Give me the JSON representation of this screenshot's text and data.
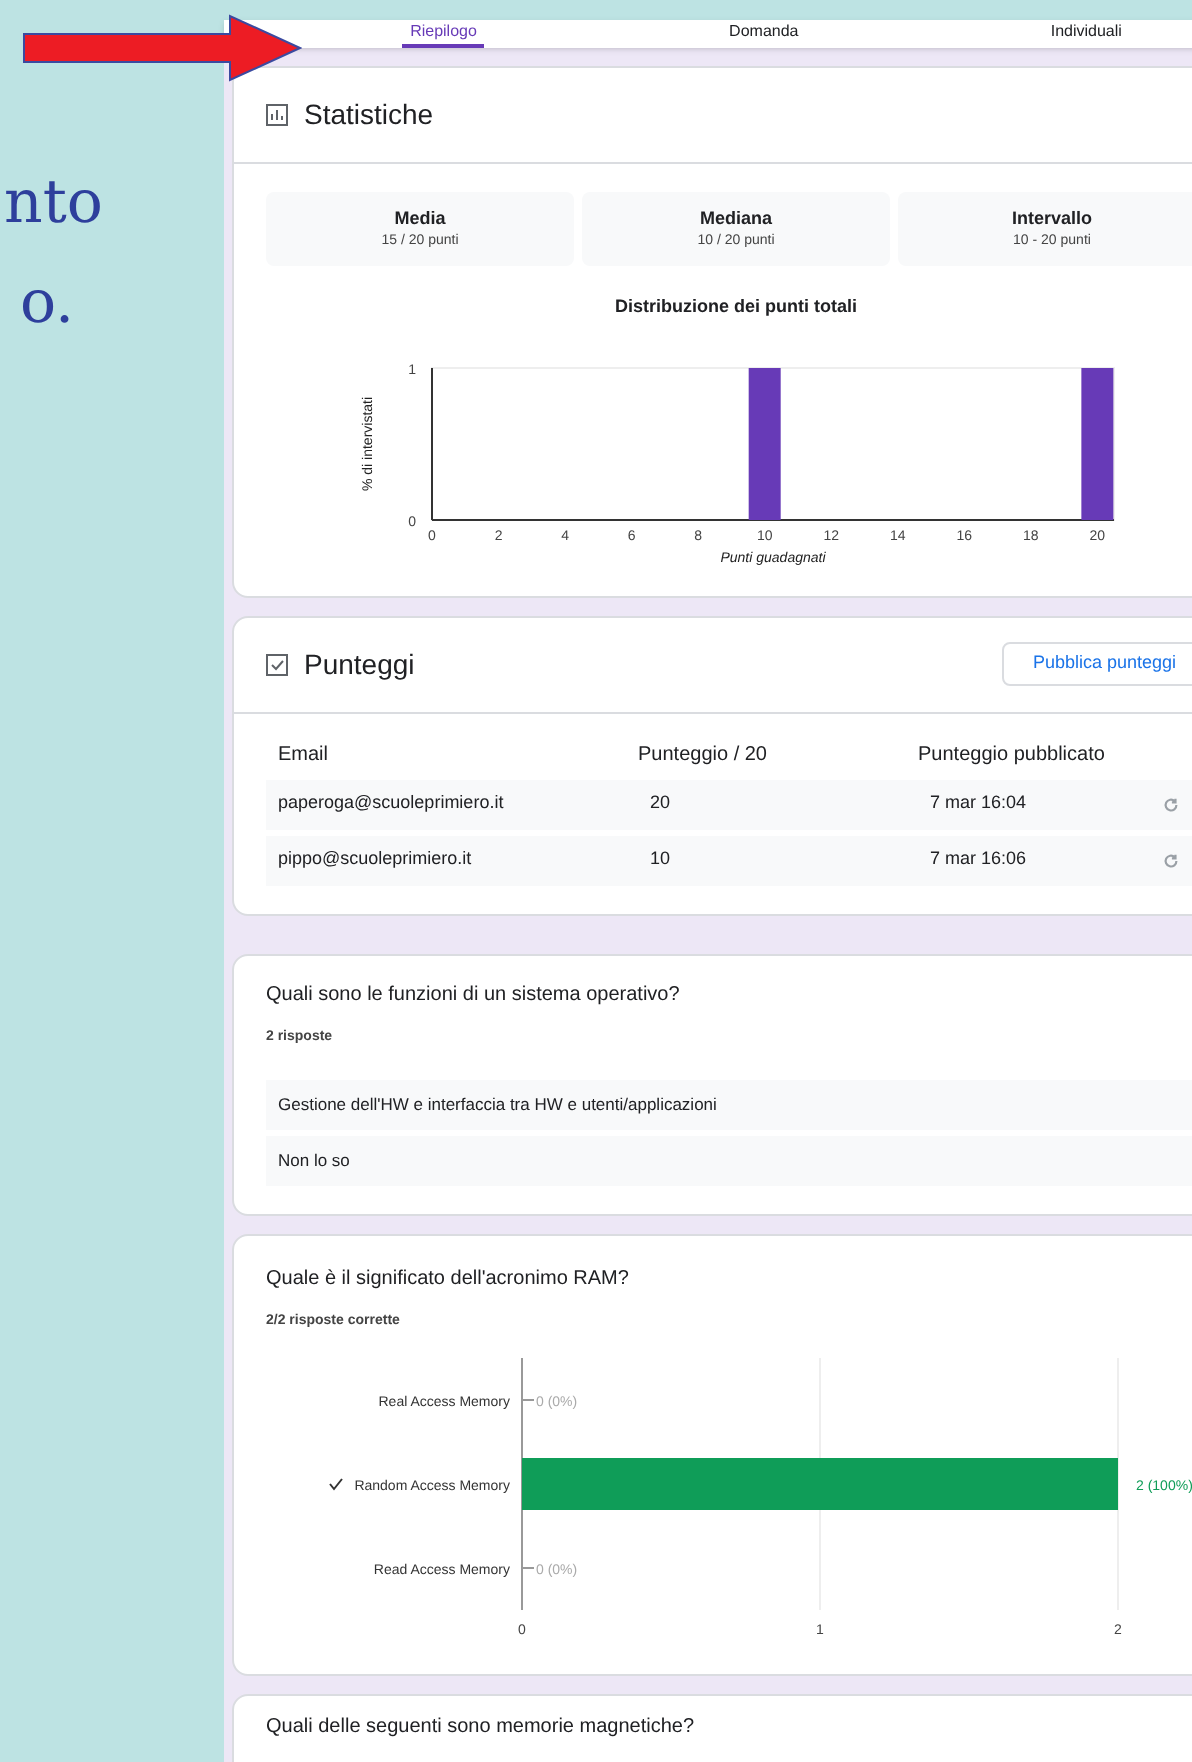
{
  "slide": {
    "text_lines": [
      "nto",
      "o."
    ]
  },
  "tabs": [
    {
      "label": "Riepilogo",
      "selected": true
    },
    {
      "label": "Domanda",
      "selected": false
    },
    {
      "label": "Individuali",
      "selected": false
    }
  ],
  "statistics": {
    "title": "Statistiche",
    "stats": [
      {
        "label": "Media",
        "value": "15 / 20 punti"
      },
      {
        "label": "Mediana",
        "value": "10 / 20 punti"
      },
      {
        "label": "Intervallo",
        "value": "10 - 20 punti"
      }
    ],
    "chart_data": {
      "type": "bar",
      "title": "Distribuzione dei punti totali",
      "xlabel": "Punti guadagnati",
      "ylabel": "% di intervistati",
      "x": [
        10,
        20
      ],
      "series": [
        {
          "color": "#673ab7",
          "values": [
            1,
            1
          ]
        }
      ],
      "xlim": [
        0,
        20.5
      ],
      "ylim": [
        0,
        1
      ],
      "xticks": [
        0,
        2,
        4,
        6,
        8,
        10,
        12,
        14,
        16,
        18,
        20
      ],
      "yticks": [
        0,
        1
      ]
    }
  },
  "scores": {
    "title": "Punteggi",
    "publish_button": "Pubblica punteggi",
    "columns": [
      "Email",
      "Punteggio / 20",
      "Punteggio pubblicato"
    ],
    "rows": [
      {
        "email": "paperoga@scuoleprimiero.it",
        "score": "20",
        "published": "7 mar 16:04"
      },
      {
        "email": "pippo@scuoleprimiero.it",
        "score": "10",
        "published": "7 mar 16:06"
      }
    ]
  },
  "questions": [
    {
      "kind": "text",
      "title": "Quali sono le funzioni di un sistema operativo?",
      "summary": "2 risposte",
      "answers": [
        "Gestione dell'HW e interfaccia tra HW e utenti/applicazioni",
        "Non lo so"
      ]
    },
    {
      "kind": "chart",
      "title": "Quale è il significato dell'acronimo RAM?",
      "summary": "2/2 risposte corrette",
      "correct": [
        false,
        true,
        false
      ],
      "chart_data": {
        "type": "bar",
        "orientation": "horizontal",
        "categories": [
          "Real Access Memory",
          "Random Access Memory",
          "Read Access Memory"
        ],
        "series": [
          {
            "color": "#0f9d58",
            "values": [
              0,
              2,
              0
            ]
          }
        ],
        "xlim": [
          0,
          2
        ],
        "xticks": [
          0,
          1,
          2
        ],
        "value_labels": [
          "0 (0%)",
          "2 (100%)",
          "0 (0%)"
        ]
      }
    },
    {
      "kind": "partial",
      "title": "Quali delle seguenti sono memorie magnetiche?"
    }
  ]
}
